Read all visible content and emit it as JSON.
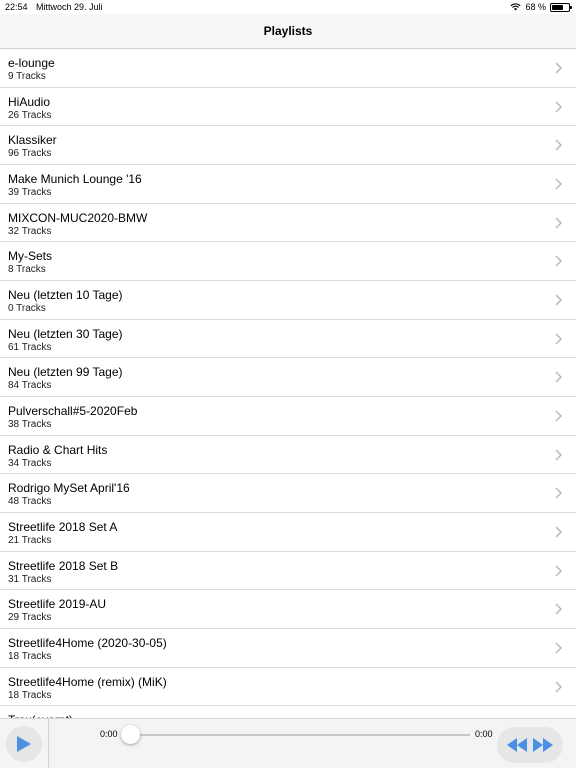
{
  "status_bar": {
    "time": "22:54",
    "date": "Mittwoch 29. Juli",
    "battery": "68 %",
    "battery_level": 0.68
  },
  "nav": {
    "title": "Playlists"
  },
  "playlists": [
    {
      "name": "e-lounge",
      "tracks": "9 Tracks"
    },
    {
      "name": "HiAudio",
      "tracks": "26 Tracks"
    },
    {
      "name": "Klassiker",
      "tracks": "96 Tracks"
    },
    {
      "name": "Make Munich Lounge '16",
      "tracks": "39 Tracks"
    },
    {
      "name": "MIXCON-MUC2020-BMW",
      "tracks": "32 Tracks"
    },
    {
      "name": "My-Sets",
      "tracks": "8 Tracks"
    },
    {
      "name": "Neu (letzten 10 Tage)",
      "tracks": "0 Tracks"
    },
    {
      "name": "Neu (letzten 30 Tage)",
      "tracks": "61 Tracks"
    },
    {
      "name": "Neu (letzten 99 Tage)",
      "tracks": "84 Tracks"
    },
    {
      "name": "Pulverschall#5-2020Feb",
      "tracks": "38 Tracks"
    },
    {
      "name": "Radio & Chart Hits",
      "tracks": "34 Tracks"
    },
    {
      "name": "Rodrigo MySet April'16",
      "tracks": "48 Tracks"
    },
    {
      "name": "Streetlife 2018 Set A",
      "tracks": "21 Tracks"
    },
    {
      "name": "Streetlife 2018 Set B",
      "tracks": "31 Tracks"
    },
    {
      "name": "Streetlife 2019-AU",
      "tracks": "29 Tracks"
    },
    {
      "name": "Streetlife4Home (2020-30-05)",
      "tracks": "18 Tracks"
    },
    {
      "name": "Streetlife4Home (remix) (MiK)",
      "tracks": "18 Tracks"
    },
    {
      "name": "Trax(everpt)",
      "tracks": ""
    }
  ],
  "player": {
    "elapsed": "0:00",
    "remaining": "0:00",
    "progress": 0,
    "accent_color": "#4a90e2"
  },
  "icons": {
    "row_chevron": "chevron-right-icon",
    "play": "play-icon",
    "rewind": "rewind-icon",
    "fast_forward": "fast-forward-icon"
  }
}
